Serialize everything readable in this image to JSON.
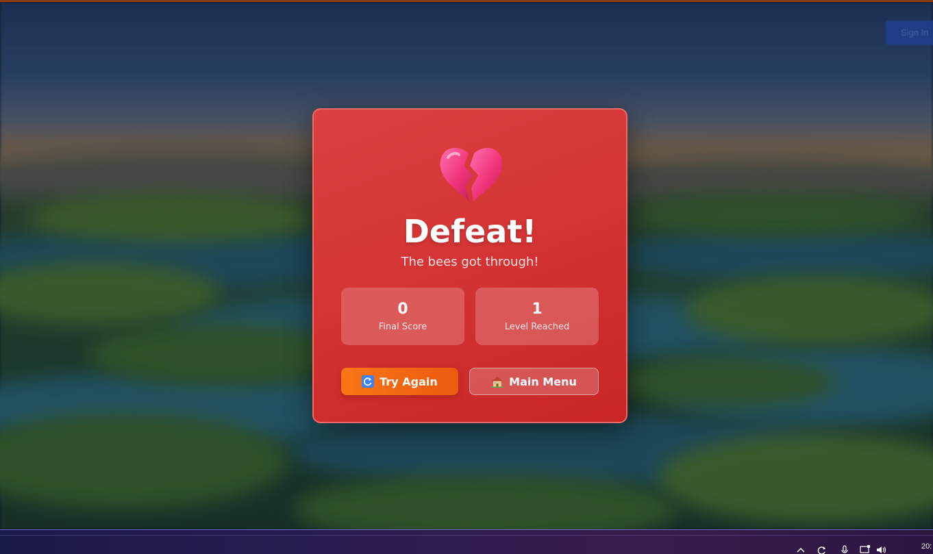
{
  "background": {
    "scene": "marsh-landscape",
    "signin_label": "Sign In"
  },
  "modal": {
    "icon": "broken-heart-icon",
    "title": "Defeat!",
    "subtitle": "The bees got through!",
    "stats": [
      {
        "value": "0",
        "label": "Final Score"
      },
      {
        "value": "1",
        "label": "Level Reached"
      }
    ],
    "buttons": {
      "try_again": {
        "icon": "refresh-icon",
        "label": "Try Again"
      },
      "main_menu": {
        "icon": "house-icon",
        "label": "Main Menu"
      }
    },
    "colors": {
      "panel": "#d33232",
      "border": "#ef6a68",
      "try_again": "#f97616"
    }
  },
  "taskbar": {
    "tray_icons": [
      "chevron-up-icon",
      "refresh-icon",
      "microphone-icon",
      "network-icon",
      "speaker-icon"
    ],
    "clock": "20:"
  }
}
